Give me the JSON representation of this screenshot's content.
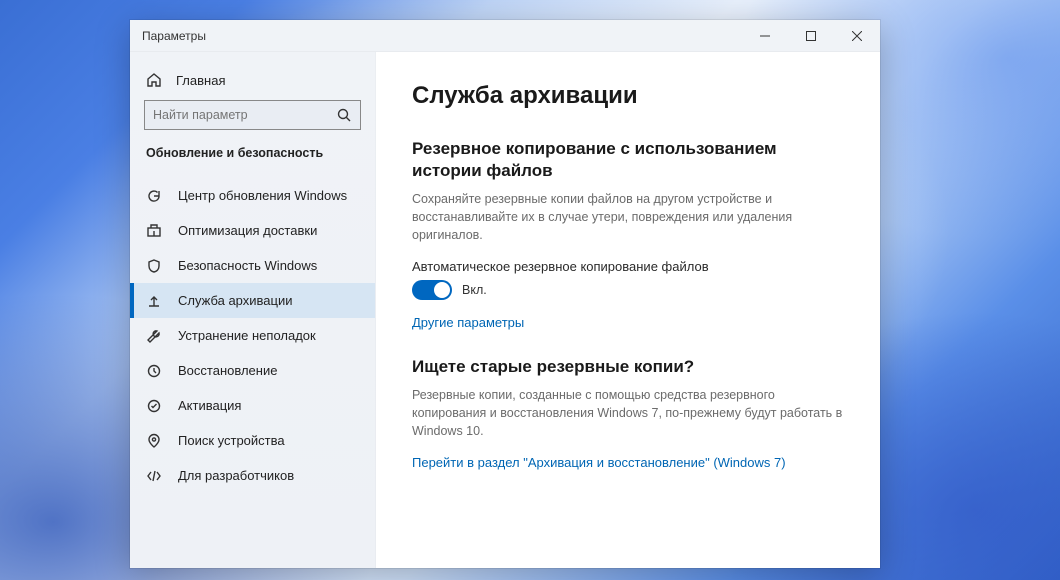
{
  "window": {
    "title": "Параметры"
  },
  "sidebar": {
    "home_label": "Главная",
    "search_placeholder": "Найти параметр",
    "category_label": "Обновление и безопасность",
    "items": [
      {
        "label": "Центр обновления Windows"
      },
      {
        "label": "Оптимизация доставки"
      },
      {
        "label": "Безопасность Windows"
      },
      {
        "label": "Служба архивации"
      },
      {
        "label": "Устранение неполадок"
      },
      {
        "label": "Восстановление"
      },
      {
        "label": "Активация"
      },
      {
        "label": "Поиск устройства"
      },
      {
        "label": "Для разработчиков"
      }
    ]
  },
  "main": {
    "page_title": "Служба архивации",
    "section1": {
      "title": "Резервное копирование с использованием истории файлов",
      "desc": "Сохраняйте резервные копии файлов на другом устройстве и восстанавливайте их в случае утери, повреждения или удаления оригиналов.",
      "toggle_label": "Автоматическое резервное копирование файлов",
      "toggle_state": "Вкл.",
      "more_link": "Другие параметры"
    },
    "section2": {
      "title": "Ищете старые резервные копии?",
      "desc": "Резервные копии, созданные с помощью средства резервного копирования и восстановления Windows 7, по-прежнему будут работать в Windows 10.",
      "link": "Перейти в раздел \"Архивация и восстановление\" (Windows 7)"
    }
  }
}
